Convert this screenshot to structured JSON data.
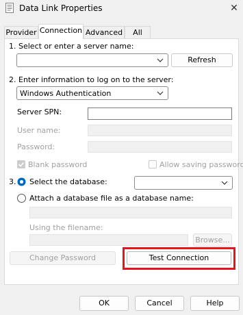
{
  "window": {
    "title": "Data Link Properties",
    "close_glyph": "✕"
  },
  "tabs": [
    {
      "label": "Provider"
    },
    {
      "label": "Connection",
      "active": true
    },
    {
      "label": "Advanced"
    },
    {
      "label": "All"
    }
  ],
  "step1": {
    "label": "1. Select or enter a server name:",
    "server_value": "",
    "refresh_label": "Refresh"
  },
  "step2": {
    "label": "2. Enter information to log on to the server:",
    "auth_value": "Windows Authentication",
    "spn_label": "Server SPN:",
    "spn_value": "",
    "username_label": "User name:",
    "password_label": "Password:",
    "blank_password_label": "Blank password",
    "allow_saving_label": "Allow saving password"
  },
  "step3": {
    "number": "3.",
    "select_db_label": "Select the database:",
    "database_value": "",
    "attach_label": "Attach a database file as a database name:",
    "filename_label": "Using the filename:",
    "browse_label": "Browse..."
  },
  "change_password_label": "Change Password",
  "test_connection_label": "Test Connection",
  "footer": {
    "ok": "OK",
    "cancel": "Cancel",
    "help": "Help"
  },
  "colors": {
    "highlight": "#e8141b",
    "radio_selected": "#0067c0"
  }
}
